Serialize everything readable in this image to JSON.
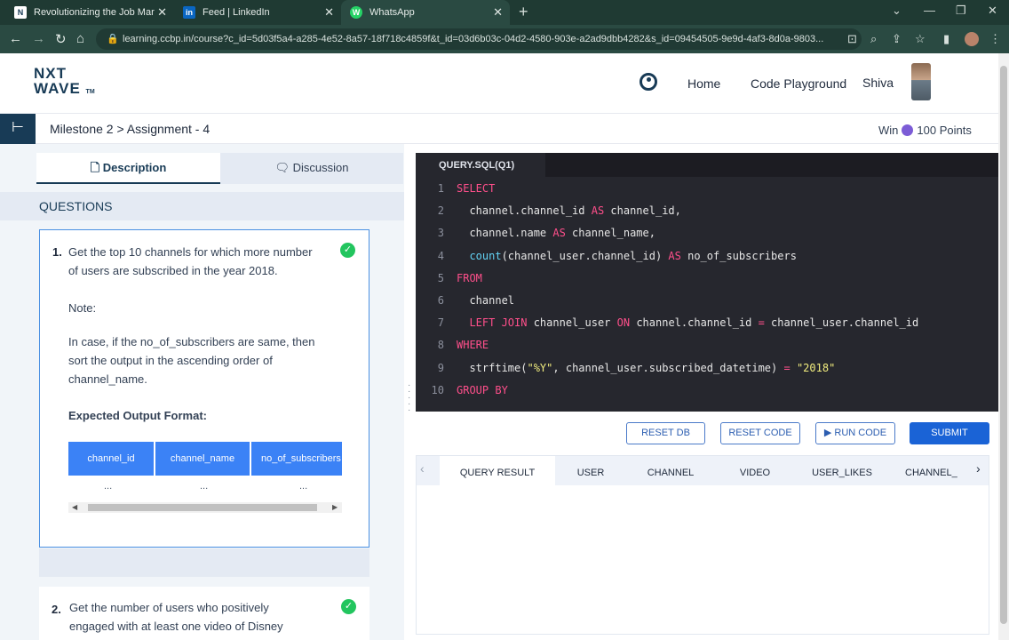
{
  "browser": {
    "tabs": [
      {
        "title": "Revolutionizing the Job Market |",
        "favicon": "N"
      },
      {
        "title": "Feed | LinkedIn",
        "favicon": "in"
      },
      {
        "title": "WhatsApp",
        "favicon": "W"
      }
    ],
    "url": "learning.ccbp.in/course?c_id=5d03f5a4-a285-4e52-8a57-18f718c4859f&t_id=03d6b03c-04d2-4580-903e-a2ad9dbb4282&s_id=09454505-9e9d-4af3-8d0a-9803..."
  },
  "header": {
    "logo_top": "NXT",
    "logo_bottom": "WAVE",
    "logo_tm": "TM",
    "nav": [
      "Home",
      "Code Playground"
    ],
    "user_name": "Shiva"
  },
  "milestone": {
    "breadcrumb": "Milestone 2 > Assignment - 4",
    "win_label": "Win",
    "points": "100 Points"
  },
  "left": {
    "tabs": [
      "Description",
      "Discussion"
    ],
    "questions_heading": "QUESTIONS",
    "q1": {
      "number": "1.",
      "text_line1": "Get the top 10 channels for which more number",
      "text_line2": "of users are subscribed in the year 2018.",
      "note_heading": "Note:",
      "note_line1": "In case, if the no_of_subscribers are same, then",
      "note_line2": "sort the output in the ascending order of",
      "note_line3": "channel_name.",
      "expected_heading": "Expected Output Format:",
      "columns": [
        "channel_id",
        "channel_name",
        "no_of_subscribers"
      ],
      "row": [
        "...",
        "...",
        "..."
      ]
    },
    "q2": {
      "number": "2.",
      "text_line1": "Get the number of users who positively",
      "text_line2": "engaged with at least one video of Disney"
    }
  },
  "editor": {
    "tab": "QUERY.SQL(Q1)",
    "lines": [
      {
        "n": "1",
        "parts": [
          {
            "t": "SELECT",
            "c": "kw"
          }
        ]
      },
      {
        "n": "2",
        "parts": [
          {
            "t": "  channel.channel_id ",
            "c": ""
          },
          {
            "t": "AS",
            "c": "kw"
          },
          {
            "t": " channel_id,",
            "c": ""
          }
        ]
      },
      {
        "n": "3",
        "parts": [
          {
            "t": "  channel.name ",
            "c": ""
          },
          {
            "t": "AS",
            "c": "kw"
          },
          {
            "t": " channel_name,",
            "c": ""
          }
        ]
      },
      {
        "n": "4",
        "parts": [
          {
            "t": "  ",
            "c": ""
          },
          {
            "t": "count",
            "c": "fn"
          },
          {
            "t": "(channel_user.channel_id) ",
            "c": ""
          },
          {
            "t": "AS",
            "c": "kw"
          },
          {
            "t": " no_of_subscribers",
            "c": ""
          }
        ]
      },
      {
        "n": "5",
        "parts": [
          {
            "t": "FROM",
            "c": "kw"
          }
        ]
      },
      {
        "n": "6",
        "parts": [
          {
            "t": "  channel",
            "c": ""
          }
        ]
      },
      {
        "n": "7",
        "parts": [
          {
            "t": "  ",
            "c": ""
          },
          {
            "t": "LEFT JOIN",
            "c": "kw"
          },
          {
            "t": " channel_user ",
            "c": ""
          },
          {
            "t": "ON",
            "c": "kw"
          },
          {
            "t": " channel.channel_id ",
            "c": ""
          },
          {
            "t": "=",
            "c": "kw"
          },
          {
            "t": " channel_user.channel_id",
            "c": ""
          }
        ]
      },
      {
        "n": "8",
        "parts": [
          {
            "t": "WHERE",
            "c": "kw"
          }
        ]
      },
      {
        "n": "9",
        "parts": [
          {
            "t": "  strftime(",
            "c": ""
          },
          {
            "t": "\"%Y\"",
            "c": "st"
          },
          {
            "t": ", channel_user.subscribed_datetime) ",
            "c": ""
          },
          {
            "t": "=",
            "c": "kw"
          },
          {
            "t": " ",
            "c": ""
          },
          {
            "t": "\"2018\"",
            "c": "st"
          }
        ]
      },
      {
        "n": "10",
        "parts": [
          {
            "t": "GROUP BY",
            "c": "kw"
          }
        ]
      }
    ]
  },
  "buttons": {
    "reset_db": "RESET DB",
    "reset_code": "RESET CODE",
    "run_code": "RUN CODE",
    "submit": "SUBMIT"
  },
  "results": {
    "tabs": [
      "QUERY RESULT",
      "USER",
      "CHANNEL",
      "VIDEO",
      "USER_LIKES",
      "CHANNEL_"
    ]
  },
  "colors": {
    "primary": "#183b56",
    "accent_blue": "#1a63d6",
    "success": "#22c55e",
    "browser_bg": "#2a4a42"
  }
}
